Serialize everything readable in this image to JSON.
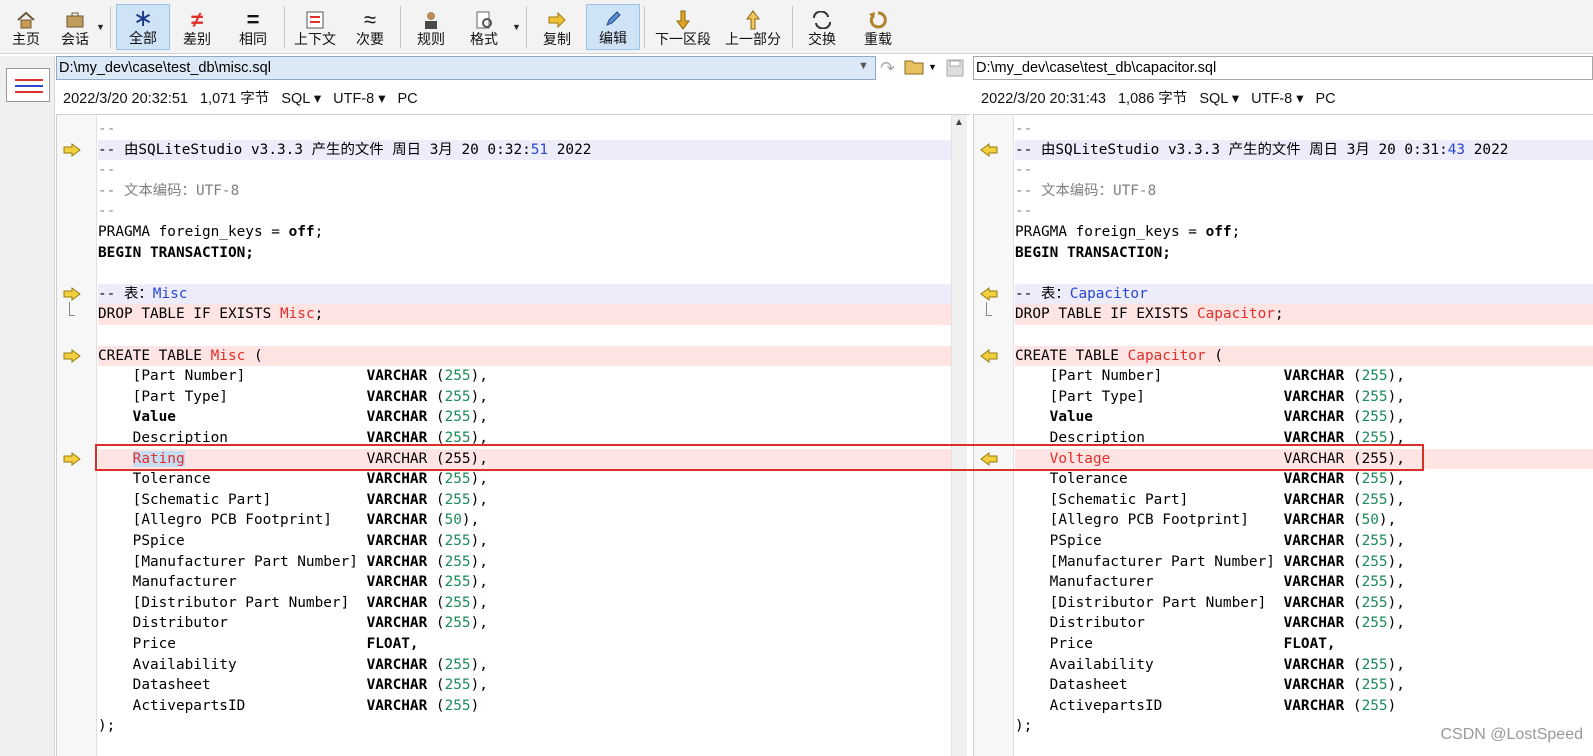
{
  "toolbar": {
    "items": [
      {
        "label": "主页",
        "icon": "home-icon"
      },
      {
        "label": "会话",
        "icon": "briefcase-icon"
      },
      {
        "label": "全部",
        "icon": "asterisk-icon",
        "active": true,
        "glyph": "∗"
      },
      {
        "label": "差别",
        "icon": "not-equal-icon",
        "glyph": "≠"
      },
      {
        "label": "相同",
        "icon": "equal-icon",
        "glyph": "="
      },
      {
        "label": "上下文",
        "icon": "context-icon"
      },
      {
        "label": "次要",
        "icon": "approx-icon",
        "glyph": "≈"
      },
      {
        "label": "规则",
        "icon": "rules-person-icon"
      },
      {
        "label": "格式",
        "icon": "format-icon"
      },
      {
        "label": "复制",
        "icon": "copy-arrow-icon"
      },
      {
        "label": "编辑",
        "icon": "edit-pencil-icon",
        "active": true
      },
      {
        "label": "下一区段",
        "icon": "down-arrow-icon"
      },
      {
        "label": "上一部分",
        "icon": "up-arrow-icon"
      },
      {
        "label": "交换",
        "icon": "swap-icon"
      },
      {
        "label": "重载",
        "icon": "reload-icon"
      }
    ]
  },
  "left": {
    "path": "D:\\my_dev\\case\\test_db\\misc.sql",
    "date": "2022/3/20 20:32:51",
    "size": "1,071 字节",
    "format": "SQL",
    "encoding": "UTF-8",
    "lineend": "PC",
    "name": "Misc",
    "time_a": "2:",
    "time_b": "51",
    "time_c": "0:3"
  },
  "right": {
    "path": "D:\\my_dev\\case\\test_db\\capacitor.sql",
    "date": "2022/3/20 20:31:43",
    "size": "1,086 字节",
    "format": "SQL",
    "encoding": "UTF-8",
    "lineend": "PC",
    "name": "Capacitor",
    "time_a": "1:",
    "time_b": "43",
    "time_c": "0:3"
  },
  "code": {
    "c1": "--",
    "c2a": "-- 由SQLiteStudio v3.3.3 产生的文件 周日 3月 20 2",
    "c2y": " 2022",
    "c4": "-- 文本编码：UTF-8",
    "pragma_a": "PRAGMA foreign_keys = ",
    "pragma_b": "off",
    ";": ";",
    "begin": "BEGIN TRANSACTION;",
    "table_a": "-- 表：",
    "drop_a": "DROP TABLE IF EXISTS ",
    "create_a": "CREATE TABLE ",
    "create_b": " (",
    "close": ");",
    "lp": " (",
    "rp": "),",
    "rpe": ")",
    "varchar": "VARCHAR",
    "float": "FLOAT,",
    "n255": "255",
    "n50": "50",
    "f1": "[Part Number]",
    "f2": "[Part Type]",
    "f3": "Value",
    "f4": "Description",
    "f5l": "Rating",
    "f5r": "Voltage",
    "f5v": "VARCHAR (255),",
    "f6": "Tolerance",
    "f7": "[Schematic Part]",
    "f8": "[Allegro PCB Footprint]",
    "f9": "PSpice",
    "f10": "[Manufacturer Part Number]",
    "f11": "Manufacturer",
    "f12": "[Distributor Part Number]",
    "f13": "Distributor",
    "f14": "Price",
    "f15": "Availability",
    "f16": "Datasheet",
    "f17": "ActivepartsID"
  },
  "watermark": "CSDN @LostSpeed",
  "colors": {
    "accent": "#2a47ce",
    "diff": "#e0302b",
    "number": "#1c8a5a",
    "box": "#d9302a"
  }
}
